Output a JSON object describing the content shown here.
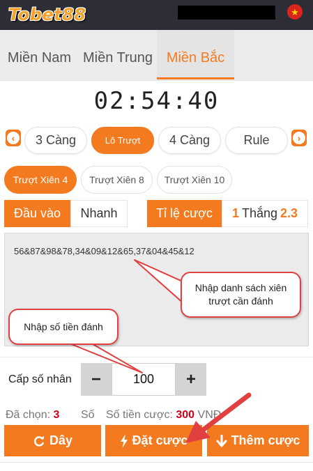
{
  "header": {
    "logo": "Tobet88",
    "flag_star": "★"
  },
  "region_tabs": [
    {
      "label": "Miền Nam"
    },
    {
      "label": "Miền Trung"
    },
    {
      "label": "Miền Bắc"
    }
  ],
  "countdown": "02:54:40",
  "game_types": [
    {
      "label": "3 Càng"
    },
    {
      "label": "Lô Trượt"
    },
    {
      "label": "4 Càng"
    },
    {
      "label": "Rule"
    }
  ],
  "nav": {
    "prev": "‹",
    "next": "›"
  },
  "sub_types": [
    {
      "label": "Trượt Xiên 4"
    },
    {
      "label": "Trượt Xiên 8"
    },
    {
      "label": "Trượt Xiên 10"
    }
  ],
  "input_modes": [
    {
      "label": "Đầu vào"
    },
    {
      "label": "Nhanh"
    }
  ],
  "ratio": {
    "label": "Tỉ lệ cược",
    "left": "1",
    "middle": "Thắng",
    "right": "2.3"
  },
  "bet_numbers": "56&87&98&78,34&09&12&65,37&04&45&12",
  "callouts": {
    "list": "Nhập danh sách xiên trượt cần đánh",
    "amount": "Nhập số tiền đánh"
  },
  "multiplier": {
    "label": "Cấp số nhân",
    "minus": "−",
    "plus": "+",
    "value": "100"
  },
  "summary": {
    "selected_label": "Đã chọn:",
    "selected_value": "3",
    "count_label": "Số",
    "amount_label": "Số tiền cược:",
    "amount_value": "300",
    "currency": "VNĐ"
  },
  "actions": [
    {
      "label": "Dây"
    },
    {
      "label": "Đặt cược"
    },
    {
      "label": "Thêm cược"
    }
  ],
  "colors": {
    "accent": "#f47a20",
    "header": "#2d2d35",
    "annotation": "#e04040",
    "highlight": "#d0021b"
  }
}
